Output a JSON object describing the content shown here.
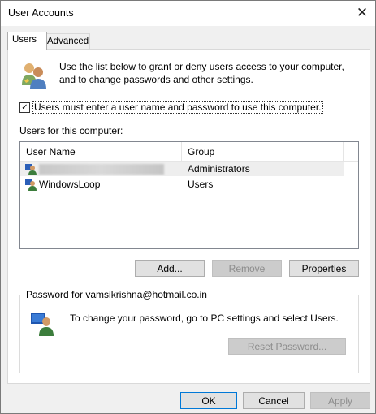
{
  "window": {
    "title": "User Accounts",
    "close_glyph": "✕"
  },
  "tabs": [
    {
      "label": "Users",
      "active": true
    },
    {
      "label": "Advanced",
      "active": false
    }
  ],
  "users_tab": {
    "description": "Use the list below to grant or deny users access to your computer, and to change passwords and other settings.",
    "must_enter_checkbox": {
      "label": "Users must enter a user name and password to use this computer.",
      "checked": true
    },
    "users_label": "Users for this computer:",
    "columns": [
      "User Name",
      "Group"
    ],
    "rows": [
      {
        "name": "",
        "name_redacted": true,
        "group": "Administrators",
        "selected": true
      },
      {
        "name": "WindowsLoop",
        "name_redacted": false,
        "group": "Users",
        "selected": false
      }
    ],
    "buttons": {
      "add": "Add...",
      "remove": "Remove",
      "properties": "Properties"
    },
    "password_group": {
      "title": "Password for vamsikrishna@hotmail.co.in",
      "text": "To change your password, go to PC settings and select Users.",
      "reset_button": "Reset Password..."
    }
  },
  "dialog_buttons": {
    "ok": "OK",
    "cancel": "Cancel",
    "apply": "Apply"
  },
  "icons": {
    "users": "users-icon",
    "user_row": "user-icon",
    "password": "password-user-icon"
  },
  "colors": {
    "titlebar": "#ffffff",
    "panel": "#ffffff",
    "background": "#f0f0f0",
    "selected_row": "#eeeeee",
    "default_button_border": "#0078d7"
  }
}
